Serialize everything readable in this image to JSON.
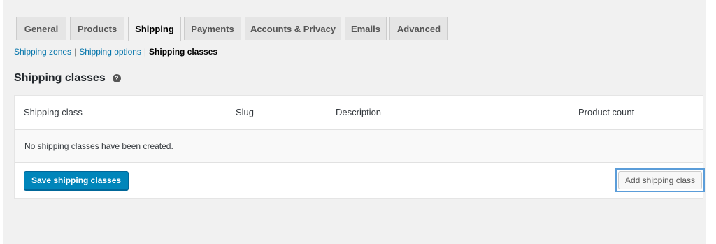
{
  "tabs": [
    {
      "label": "General",
      "active": false
    },
    {
      "label": "Products",
      "active": false
    },
    {
      "label": "Shipping",
      "active": true
    },
    {
      "label": "Payments",
      "active": false
    },
    {
      "label": "Accounts & Privacy",
      "active": false
    },
    {
      "label": "Emails",
      "active": false
    },
    {
      "label": "Advanced",
      "active": false
    }
  ],
  "subnav": {
    "zones": "Shipping zones",
    "options": "Shipping options",
    "separator": "|",
    "current": "Shipping classes"
  },
  "heading": {
    "title": "Shipping classes",
    "help_glyph": "?"
  },
  "table": {
    "columns": [
      "Shipping class",
      "Slug",
      "Description",
      "Product count"
    ],
    "empty_message": "No shipping classes have been created."
  },
  "buttons": {
    "save": "Save shipping classes",
    "add": "Add shipping class"
  },
  "colors": {
    "page_bg": "#f1f1f1",
    "link": "#0073aa",
    "primary_button": "#0085ba",
    "focus_ring": "#5b9dd9"
  }
}
